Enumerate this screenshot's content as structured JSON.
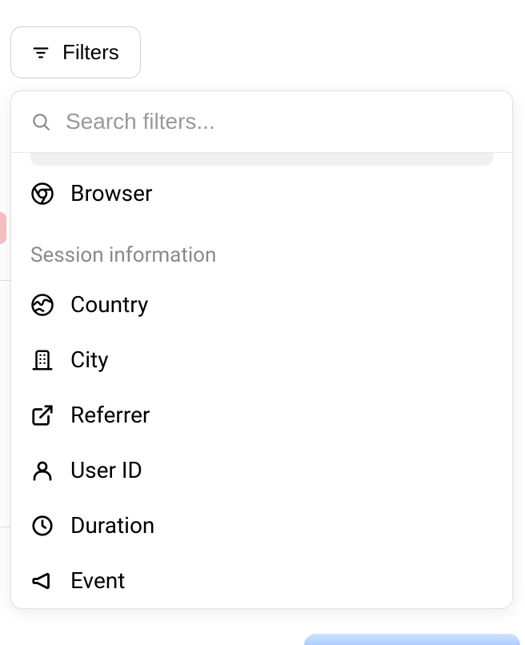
{
  "filters_button": {
    "label": "Filters"
  },
  "search": {
    "placeholder": "Search filters..."
  },
  "section_top": {
    "items": [
      {
        "id": "browser",
        "label": "Browser"
      }
    ]
  },
  "section_session": {
    "header": "Session information",
    "items": [
      {
        "id": "country",
        "label": "Country"
      },
      {
        "id": "city",
        "label": "City"
      },
      {
        "id": "referrer",
        "label": "Referrer"
      },
      {
        "id": "user-id",
        "label": "User ID"
      },
      {
        "id": "duration",
        "label": "Duration"
      },
      {
        "id": "event",
        "label": "Event"
      }
    ]
  }
}
